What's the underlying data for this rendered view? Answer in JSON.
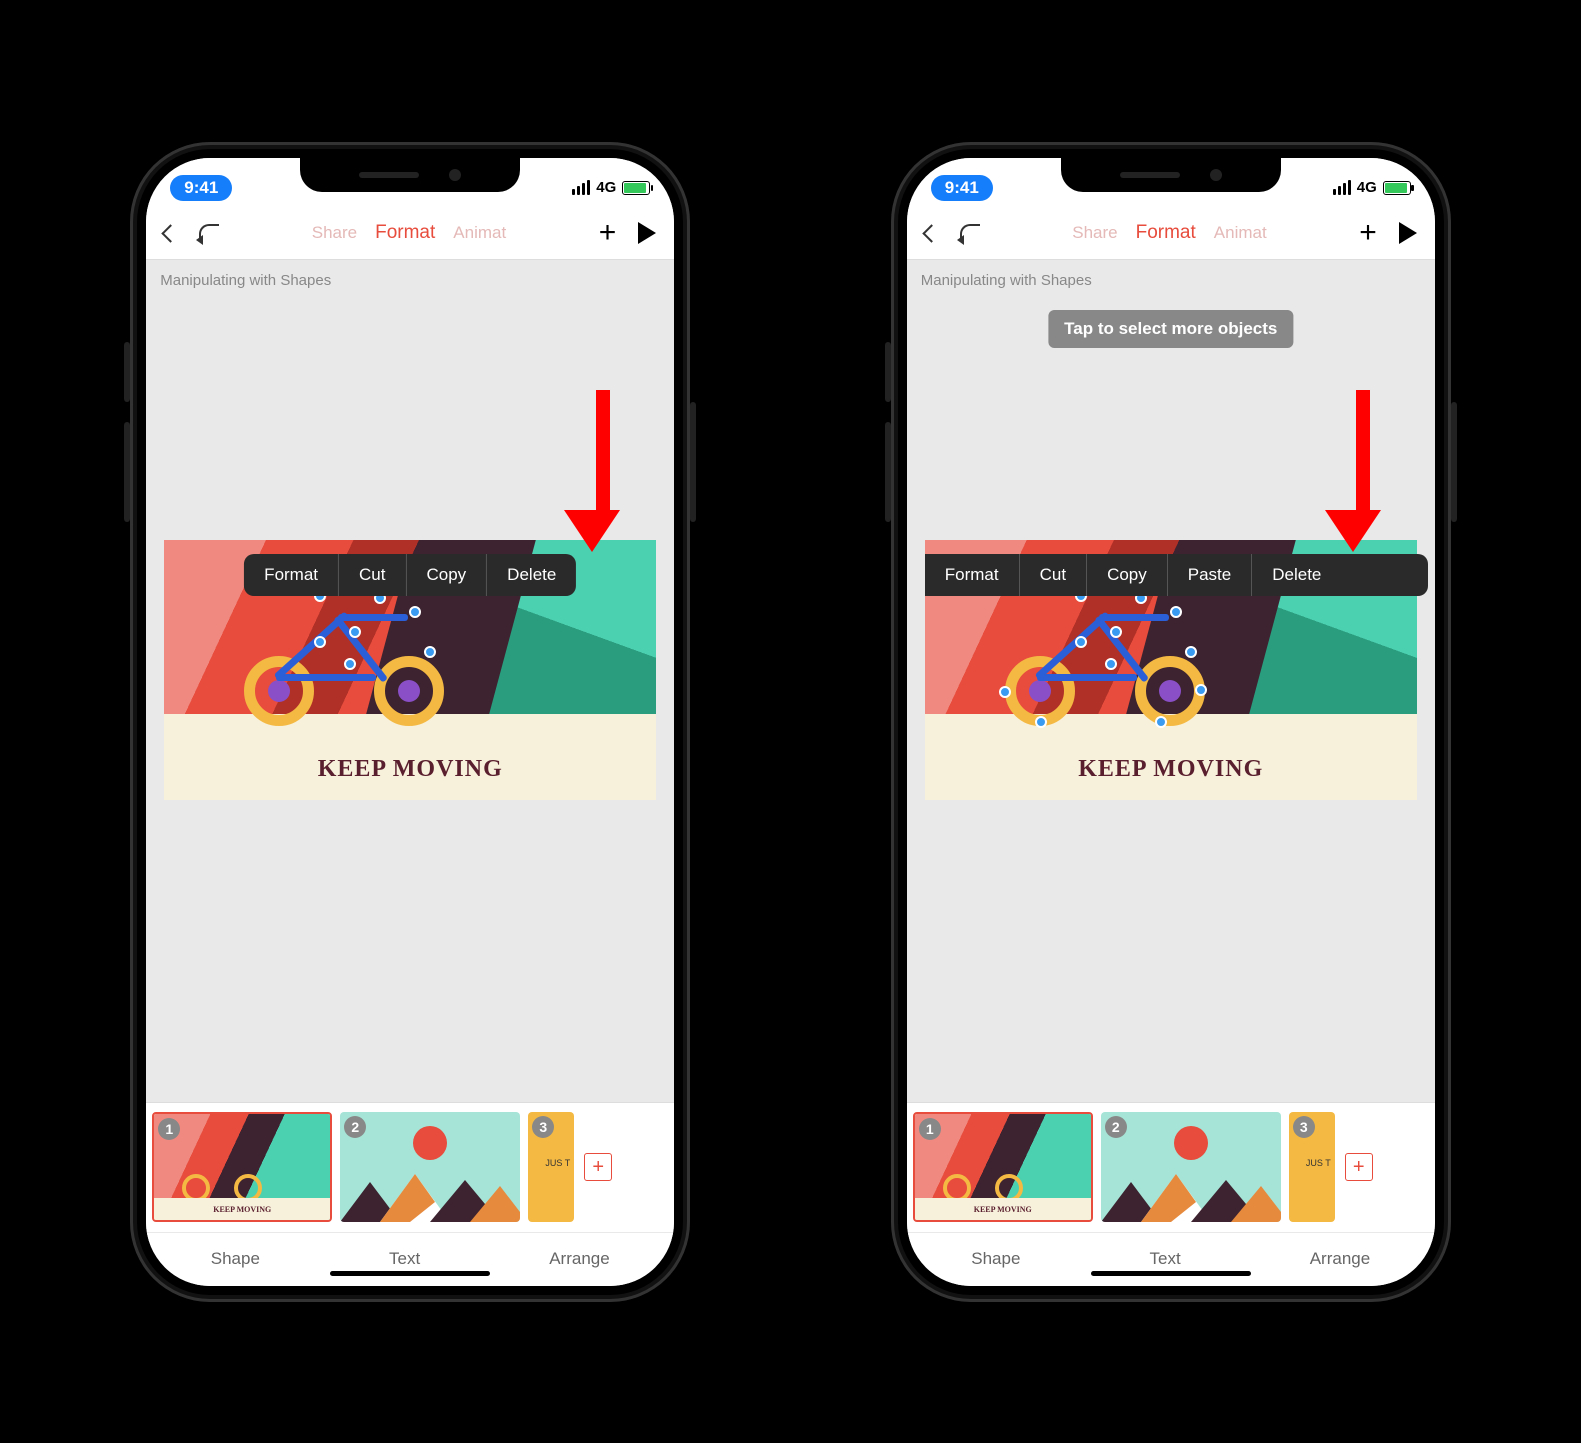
{
  "status": {
    "time": "9:41",
    "network": "4G"
  },
  "toolbar": {
    "share": "Share",
    "format": "Format",
    "animate": "Animat"
  },
  "slide_title": "Manipulating with Shapes",
  "tooltip": "Tap to select more objects",
  "context_menu": {
    "left": [
      "Format",
      "Cut",
      "Copy",
      "Delete"
    ],
    "right": [
      "Format",
      "Cut",
      "Copy",
      "Paste",
      "Delete"
    ]
  },
  "slide_caption": "KEEP MOVING",
  "thumbs": {
    "numbers": [
      "1",
      "2",
      "3"
    ],
    "thumb1_caption": "KEEP MOVING",
    "thumb3_text": "JUS\nT"
  },
  "add_slide": "+",
  "bottombar": {
    "shape": "Shape",
    "text": "Text",
    "arrange": "Arrange"
  }
}
